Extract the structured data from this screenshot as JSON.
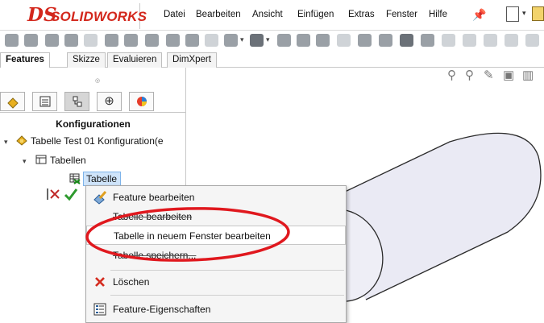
{
  "app": {
    "logo_text": "SOLIDWORKS",
    "logo_mark": "DS"
  },
  "menu": {
    "items": [
      "Datei",
      "Bearbeiten",
      "Ansicht",
      "Einfügen",
      "Extras",
      "Fenster",
      "Hilfe"
    ]
  },
  "command_tabs": [
    "Features",
    "Skizze",
    "Evaluieren",
    "DimXpert"
  ],
  "feature_manager": {
    "title": "Konfigurationen",
    "tree": [
      {
        "label": "Tabelle Test 01 Konfiguration(e"
      },
      {
        "label": "Tabellen"
      },
      {
        "label": "Tabelle"
      }
    ]
  },
  "context_menu": {
    "items": [
      {
        "label": "Feature bearbeiten",
        "icon": "edit-feature-icon"
      },
      {
        "label": "Tabelle bearbeiten",
        "icon": ""
      },
      {
        "label": "Tabelle in neuem Fenster bearbeiten",
        "icon": "",
        "highlighted": true
      },
      {
        "label": "Tabelle speichern...",
        "icon": ""
      },
      {
        "label": "Löschen",
        "icon": "delete-x-icon"
      },
      {
        "label": "Feature-Eigenschaften",
        "icon": "properties-icon"
      }
    ]
  },
  "colors": {
    "brand_red": "#d3271c",
    "annotation_red": "#e0181e",
    "confirm_green": "#2e9a2e",
    "cylinder_fill": "#eaeaf4"
  }
}
